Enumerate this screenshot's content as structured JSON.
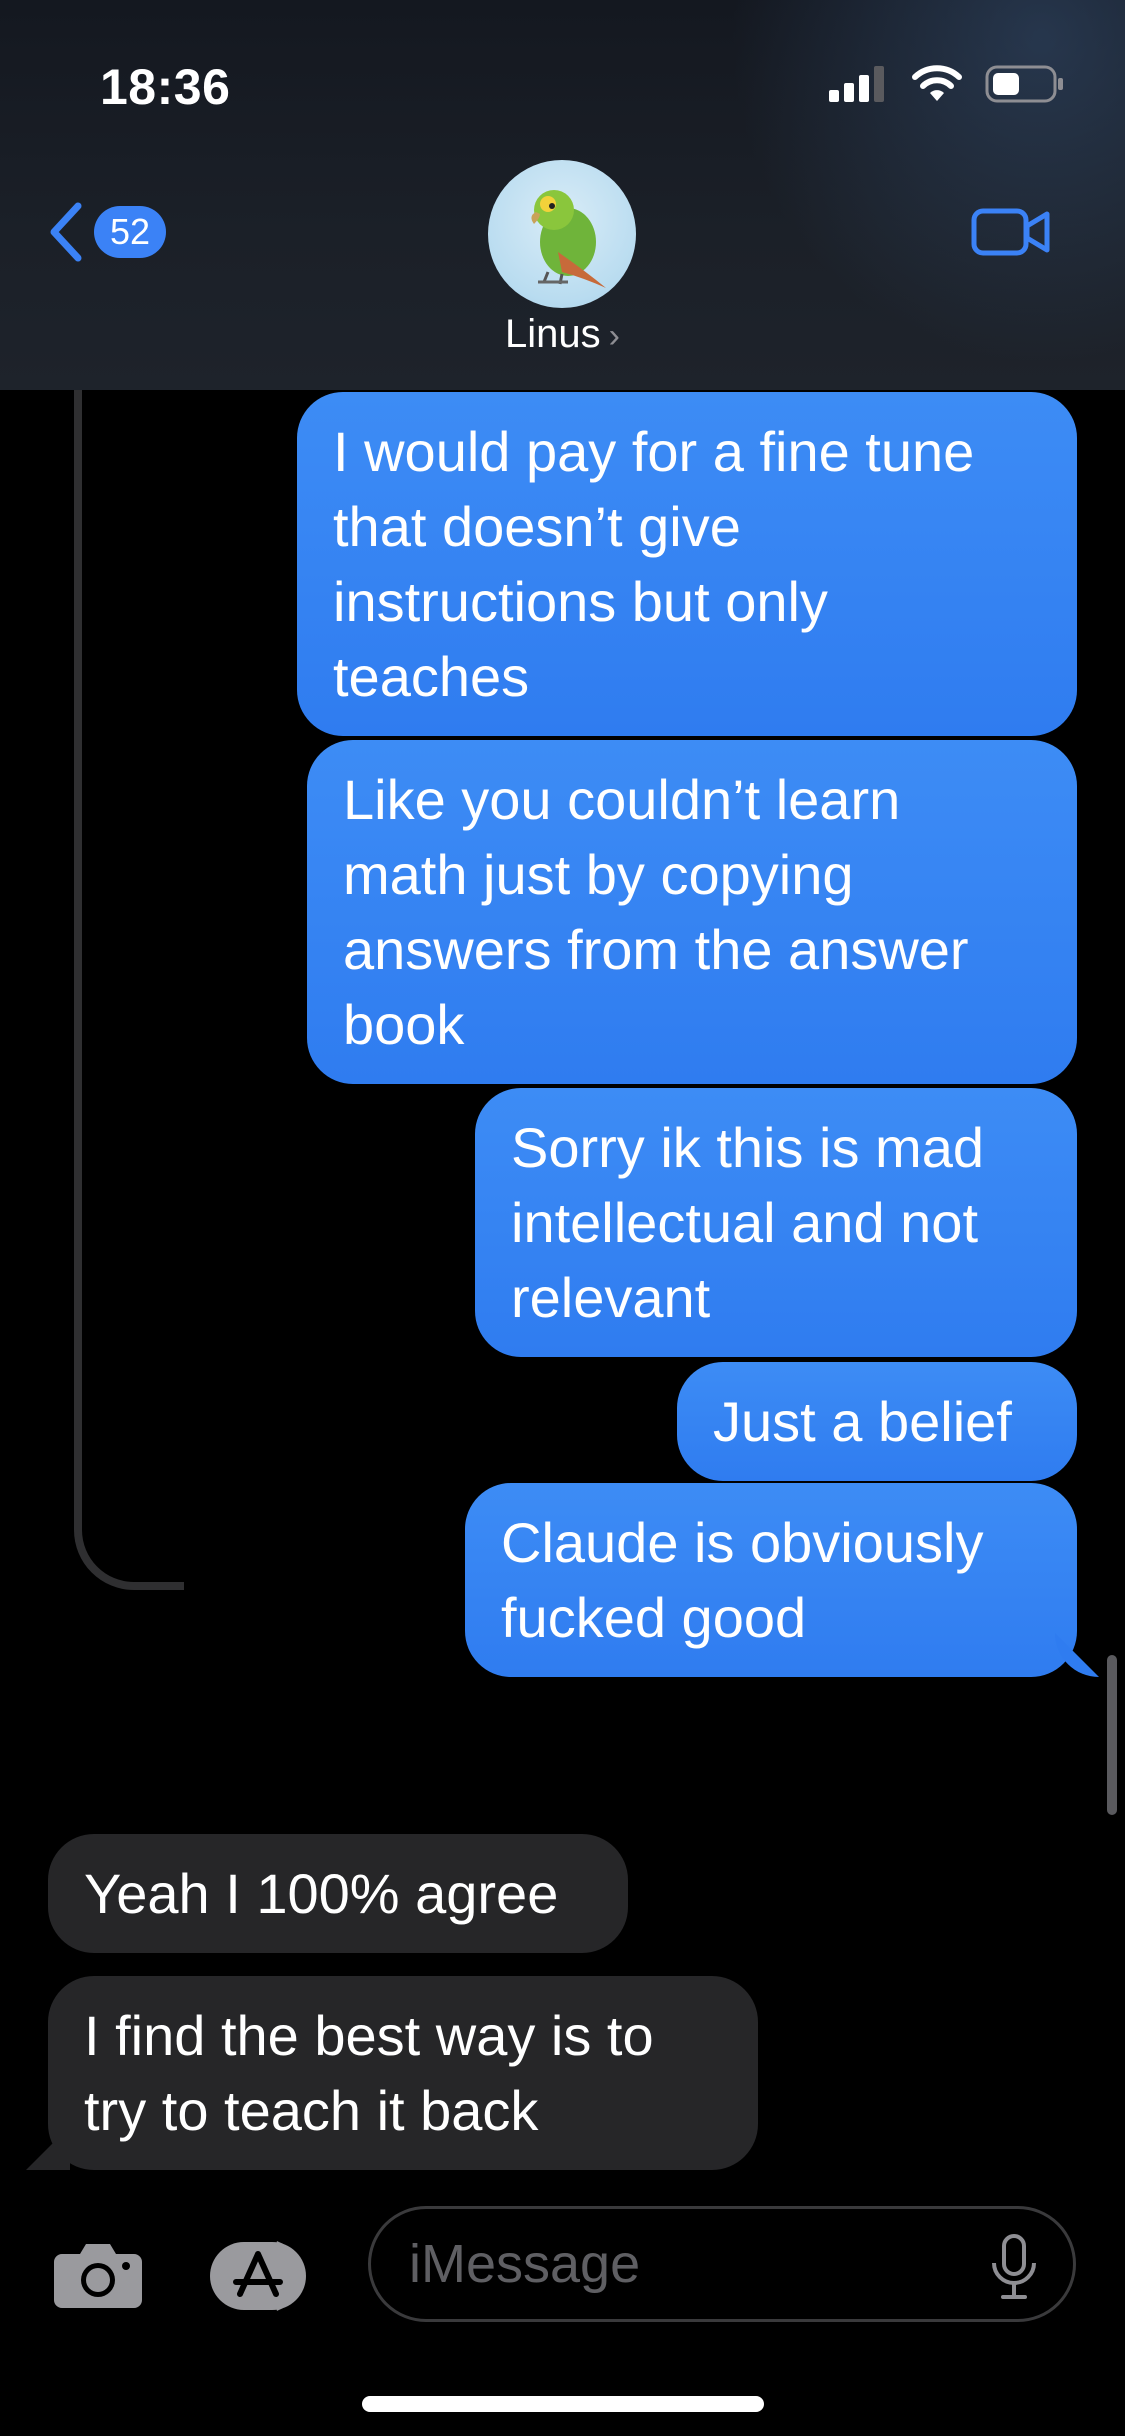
{
  "status_bar": {
    "time": "18:36"
  },
  "header": {
    "back_count": "52",
    "contact_name": "Linus",
    "name_chevron": "›"
  },
  "messages": [
    {
      "dir": "out",
      "text": "I would pay for a fine tune\nthat doesn’t give\ninstructions but only\nteaches"
    },
    {
      "dir": "out",
      "text": "Like you couldn’t learn\nmath just by copying\nanswers from the answer\nbook"
    },
    {
      "dir": "out",
      "text": "Sorry ik this is mad\nintellectual and not\nrelevant"
    },
    {
      "dir": "out",
      "text": "Just a belief"
    },
    {
      "dir": "out",
      "text": "Claude is obviously\nfucked good"
    },
    {
      "dir": "in",
      "text": "Yeah I 100% agree"
    },
    {
      "dir": "in",
      "text": "I find the best way is to\ntry to teach it back"
    }
  ],
  "composer": {
    "placeholder": "iMessage"
  },
  "colors": {
    "accent": "#3b82f6",
    "outgoing": "#3d8cf5",
    "incoming": "#262628"
  },
  "icons": [
    "signal-icon",
    "wifi-icon",
    "battery-icon",
    "back-chevron-icon",
    "parrot-avatar-icon",
    "video-camera-icon",
    "camera-icon",
    "app-store-icon",
    "microphone-icon"
  ]
}
